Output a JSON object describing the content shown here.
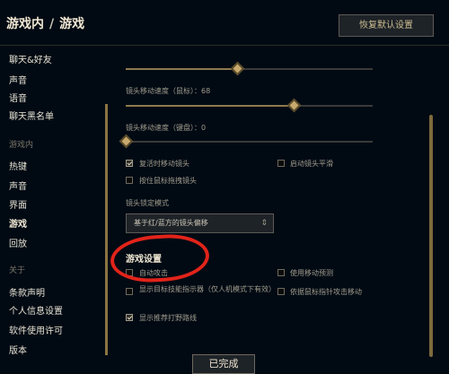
{
  "header": {
    "breadcrumb_parent": "游戏内",
    "breadcrumb_separator": "/",
    "breadcrumb_current": "游戏",
    "reset_button": "恢复默认设置"
  },
  "sidebar": {
    "items": [
      {
        "label": "聊天&好友",
        "type": "item"
      },
      {
        "label": "声音",
        "type": "item"
      },
      {
        "label": "语音",
        "type": "item"
      },
      {
        "label": "聊天黑名单",
        "type": "item"
      },
      {
        "label": "游戏内",
        "type": "group"
      },
      {
        "label": "热键",
        "type": "item"
      },
      {
        "label": "声音",
        "type": "item"
      },
      {
        "label": "界面",
        "type": "item"
      },
      {
        "label": "游戏",
        "type": "item",
        "active": true
      },
      {
        "label": "回放",
        "type": "item"
      },
      {
        "label": "关于",
        "type": "group"
      },
      {
        "label": "条款声明",
        "type": "item"
      },
      {
        "label": "个人信息设置",
        "type": "item"
      },
      {
        "label": "软件使用许可",
        "type": "item"
      },
      {
        "label": "版本",
        "type": "item"
      }
    ]
  },
  "camera": {
    "mouse_speed_label": "镜头移动速度（鼠标）：68",
    "mouse_speed_value": 68,
    "keyboard_speed_label": "镜头移动速度（键盘）：0",
    "keyboard_speed_value": 0,
    "top_slider_fraction": 0.45,
    "checkboxes": [
      {
        "label": "复活时移动镜头",
        "checked": true
      },
      {
        "label": "启动镜头平滑",
        "checked": false
      },
      {
        "label": "按住鼠标拖拽镜头",
        "checked": false
      }
    ],
    "lock_mode_label": "镜头锁定模式",
    "lock_mode_value": "基于红/蓝方的镜头偏移",
    "dropdown_icon": "chevron-updown-icon"
  },
  "game_settings": {
    "title": "游戏设置",
    "checkboxes": [
      {
        "label": "自动攻击",
        "checked": false
      },
      {
        "label": "使用移动预测",
        "checked": false
      },
      {
        "label": "显示目标技能指示器（仅人机模式下有效）",
        "checked": false
      },
      {
        "label": "依据鼠标指针攻击移动",
        "checked": false
      },
      {
        "label": "显示推荐打野路线",
        "checked": true
      }
    ]
  },
  "footer": {
    "done_button": "已完成"
  },
  "colors": {
    "background": "#010a13",
    "accent_gold": "#c8aa6e",
    "annotation_red": "#e2231a"
  }
}
